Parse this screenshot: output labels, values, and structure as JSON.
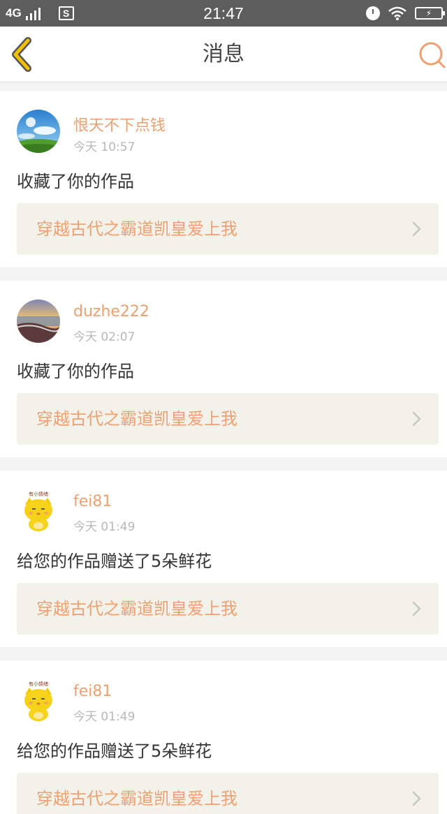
{
  "status_bar": {
    "network": "4G",
    "sim_icon": "S",
    "time": "21:47",
    "icons": [
      "signal-icon",
      "sim-icon",
      "alarm-icon",
      "wifi-icon",
      "battery-charging-icon"
    ]
  },
  "header": {
    "title": "消息",
    "back_icon": "chevron-left-icon",
    "search_icon": "search-icon"
  },
  "colors": {
    "accent": "#f0a070",
    "back_arrow": "#f2c000",
    "link_bg": "#f3f2ea",
    "text": "#333333",
    "muted": "#b8b8b8"
  },
  "messages": [
    {
      "user": "恨天不下点钱",
      "time": "今天 10:57",
      "action": "收藏了你的作品",
      "work_title": "穿越古代之霸道凯皇爱上我",
      "avatar": "landscape-avatar"
    },
    {
      "user": "duzhe222",
      "time": "今天 02:07",
      "action": "收藏了你的作品",
      "work_title": "穿越古代之霸道凯皇爱上我",
      "avatar": "beach-avatar"
    },
    {
      "user": "fei81",
      "time": "今天 01:49",
      "action": "给您的作品赠送了5朵鲜花",
      "work_title": "穿越古代之霸道凯皇爱上我",
      "avatar": "cat-avatar",
      "avatar_caption": "有小情绪"
    },
    {
      "user": "fei81",
      "time": "今天 01:49",
      "action": "给您的作品赠送了5朵鲜花",
      "work_title": "穿越古代之霸道凯皇爱上我",
      "avatar": "cat-avatar",
      "avatar_caption": "有小情绪"
    }
  ]
}
